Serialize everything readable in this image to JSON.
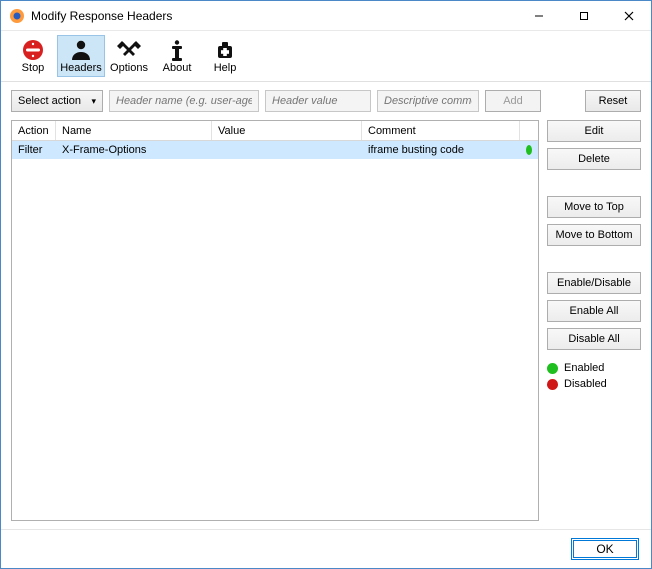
{
  "window": {
    "title": "Modify Response Headers",
    "controls": {
      "minimize": "—",
      "maximize": "☐",
      "close": "✕"
    }
  },
  "toolbar": {
    "items": [
      {
        "label": "Stop",
        "icon": "stop-icon"
      },
      {
        "label": "Headers",
        "icon": "headers-icon",
        "active": true
      },
      {
        "label": "Options",
        "icon": "options-icon"
      },
      {
        "label": "About",
        "icon": "about-icon"
      },
      {
        "label": "Help",
        "icon": "help-icon"
      }
    ]
  },
  "form": {
    "select_action_label": "Select action",
    "header_name_placeholder": "Header name (e.g. user-agent)",
    "header_value_placeholder": "Header value",
    "comment_placeholder": "Descriptive comment",
    "add_label": "Add",
    "reset_label": "Reset"
  },
  "table": {
    "columns": {
      "action": "Action",
      "name": "Name",
      "value": "Value",
      "comment": "Comment"
    },
    "rows": [
      {
        "action": "Filter",
        "name": "X-Frame-Options",
        "value": "",
        "comment": "iframe busting code",
        "enabled": true,
        "selected": true
      }
    ]
  },
  "side": {
    "edit": "Edit",
    "delete": "Delete",
    "move_top": "Move to Top",
    "move_bottom": "Move to Bottom",
    "enable_disable": "Enable/Disable",
    "enable_all": "Enable All",
    "disable_all": "Disable All"
  },
  "legend": {
    "enabled_label": "Enabled",
    "disabled_label": "Disabled",
    "enabled_color": "#1fbf1f",
    "disabled_color": "#d01717"
  },
  "footer": {
    "ok_label": "OK"
  }
}
